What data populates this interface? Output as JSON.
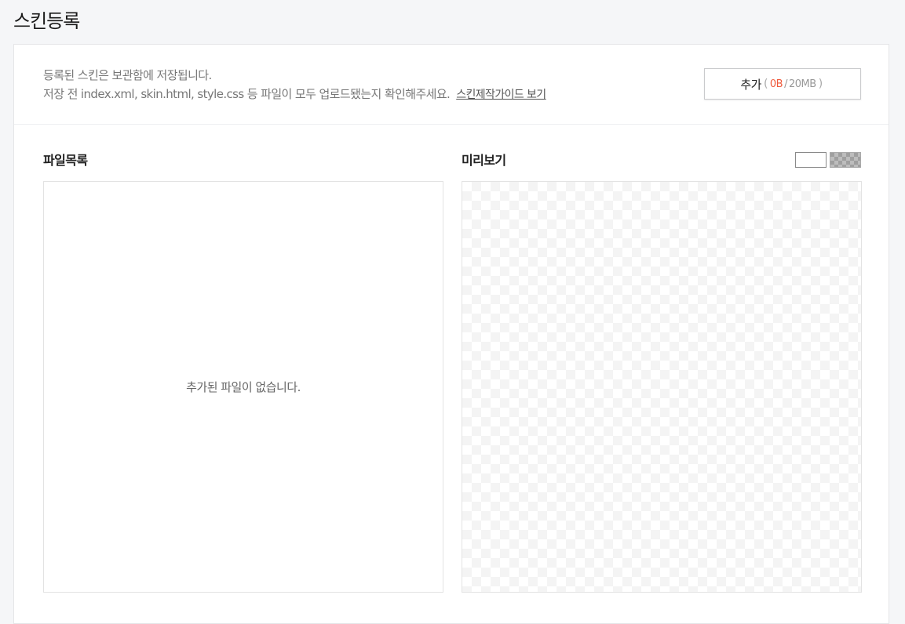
{
  "page": {
    "title": "스킨등록"
  },
  "notice": {
    "line1": "등록된 스킨은 보관함에 저장됩니다.",
    "line2": "저장 전 index.xml, skin.html, style.css 등 파일이 모두 업로드됐는지 확인해주세요.",
    "guide_link": "스킨제작가이드 보기"
  },
  "add_button": {
    "label": "추가",
    "open_paren": "(",
    "used": "0B",
    "slash": "/",
    "limit": "20MB",
    "close_paren": ")"
  },
  "files": {
    "title": "파일목록",
    "empty_message": "추가된 파일이 없습니다."
  },
  "preview": {
    "title": "미리보기",
    "bg_options": [
      "white",
      "checker"
    ]
  },
  "colors": {
    "accent_used": "#ef5a3c",
    "page_background": "#f5f6f8"
  }
}
